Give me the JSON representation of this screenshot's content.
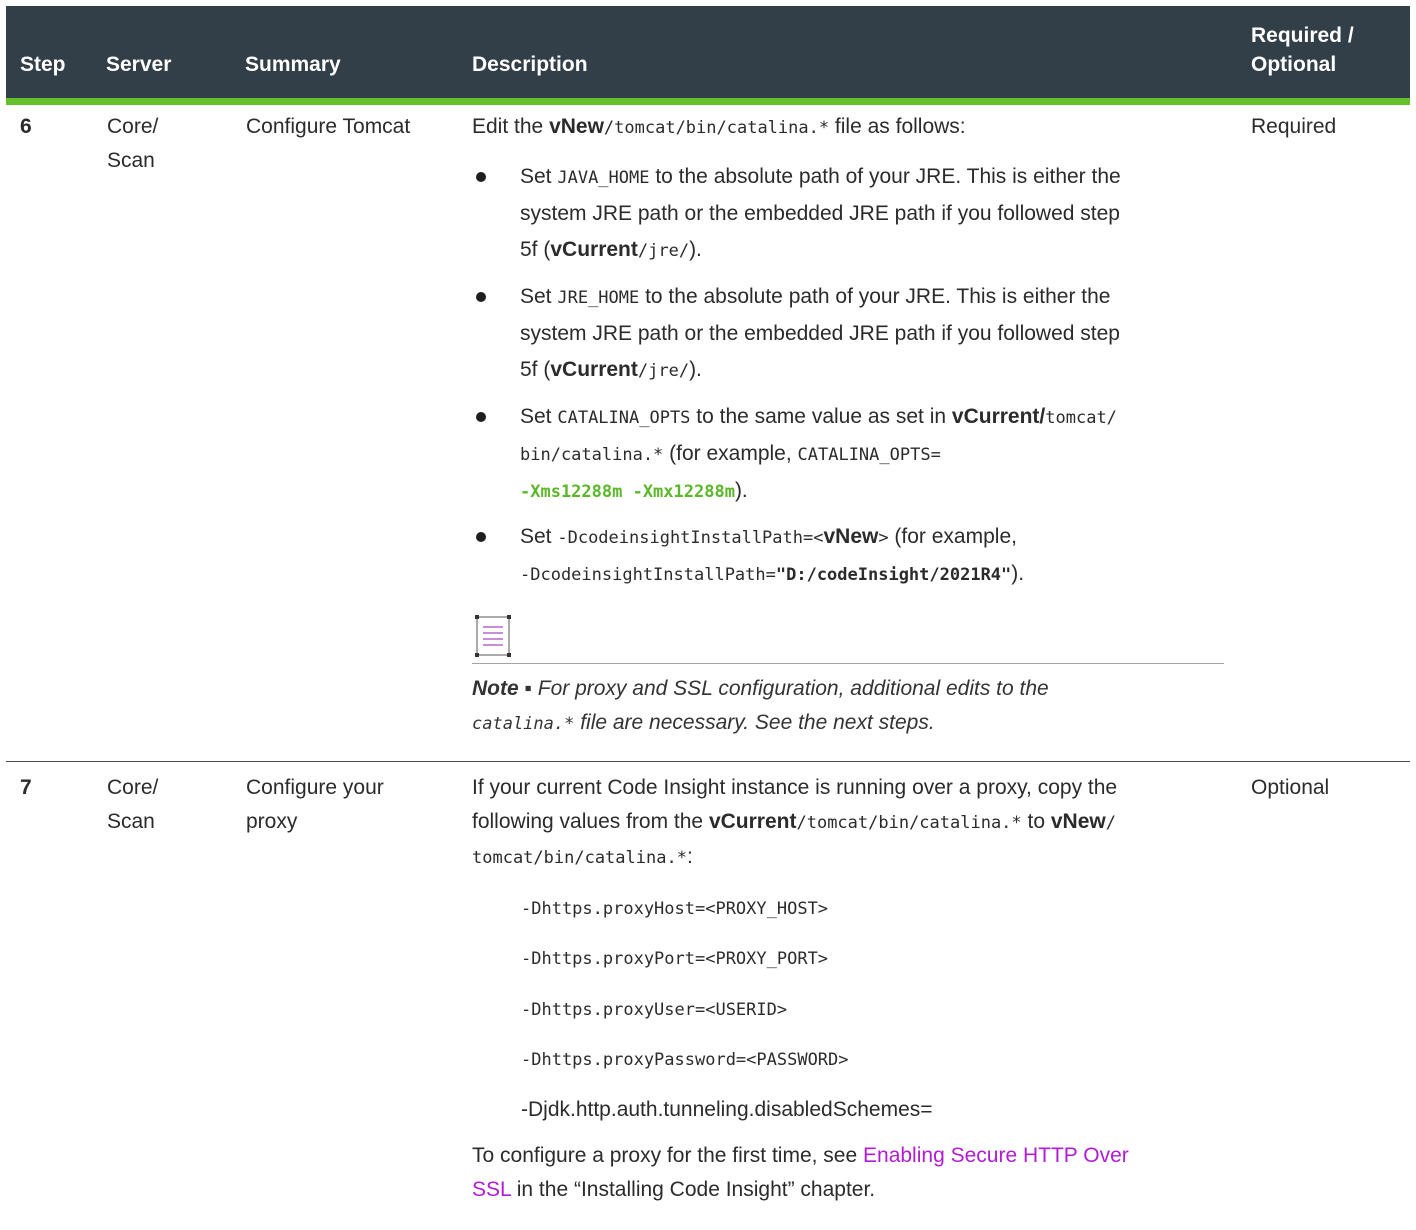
{
  "header": {
    "step": "Step",
    "server": "Server",
    "summary": "Summary",
    "description": "Description",
    "required_line1": "Required /",
    "required_line2": "Optional"
  },
  "row6": {
    "step": "6",
    "server_line1": "Core/",
    "server_line2": "Scan",
    "summary": "Configure Tomcat",
    "required": "Required",
    "intro": {
      "pre": "Edit the ",
      "bold": "vNew",
      "code": "/tomcat/bin/catalina.*",
      "post": " file as follows:"
    },
    "bullet1": {
      "set": "Set ",
      "code": "JAVA_HOME",
      "l1": " to the absolute path of your JRE. This is either the",
      "l2": "system JRE path or the embedded JRE path if you followed step",
      "l3_pre": "5f (",
      "l3_bold": "vCurrent",
      "l3_code": "/jre/",
      "l3_post": ")."
    },
    "bullet2": {
      "set": "Set ",
      "code": "JRE_HOME",
      "l1": " to the absolute path of your JRE. This is either the",
      "l2": "system JRE path or the embedded JRE path if you followed step",
      "l3_pre": "5f (",
      "l3_bold": "vCurrent",
      "l3_code": "/jre/",
      "l3_post": ")."
    },
    "bullet3": {
      "set": "Set ",
      "code1": "CATALINA_OPTS",
      "mid": " to the same value as set in ",
      "bold": "vCurrent/",
      "code2": "tomcat/",
      "l2_code": "bin/catalina.*",
      "l2_text": " (for example, ",
      "l2_code2": "CATALINA_OPTS=",
      "l3_green": "-Xms12288m -Xmx12288m",
      "l3_post": ")."
    },
    "bullet4": {
      "set": "Set ",
      "code1": "-DcodeinsightInstallPath=<",
      "bold": "vNew",
      "code2": ">",
      "text": " (for example,",
      "l2_code": "-DcodeinsightInstallPath=",
      "l2_bold": "\"D:/codeInsight/2021R4\"",
      "l2_post": ")."
    },
    "note": {
      "label": "Note ▪ ",
      "l1": "For proxy and SSL configuration, additional edits to the",
      "l2_code": "catalina.*",
      "l2_post": " file are necessary. See the next steps."
    }
  },
  "row7": {
    "step": "7",
    "server_line1": "Core/",
    "server_line2": "Scan",
    "summary_line1": "Configure your",
    "summary_line2": "proxy",
    "required": "Optional",
    "intro_l1": "If your current Code Insight instance is running over a proxy, copy the",
    "intro_l2_pre": "following values from the ",
    "intro_l2_bold": "vCurrent",
    "intro_l2_code": "/tomcat/bin/catalina.*",
    "intro_l2_mid": " to ",
    "intro_l2_bold2": "vNew",
    "intro_l2_post": "/",
    "intro_l3_code": "tomcat/bin/catalina.*",
    "intro_l3_post": ":",
    "code_lines": [
      "-Dhttps.proxyHost=<PROXY_HOST>",
      "-Dhttps.proxyPort=<PROXY_PORT>",
      "-Dhttps.proxyUser=<USERID>",
      "-Dhttps.proxyPassword=<PASSWORD>"
    ],
    "plain_line": "-Djdk.http.auth.tunneling.disabledSchemes=",
    "outro_l1_pre": "To configure a proxy for the first time, see ",
    "outro_link_l1": "Enabling Secure HTTP Over",
    "outro_link_l2": "SSL",
    "outro_l2_post": " in the “Installing Code Insight” chapter."
  }
}
